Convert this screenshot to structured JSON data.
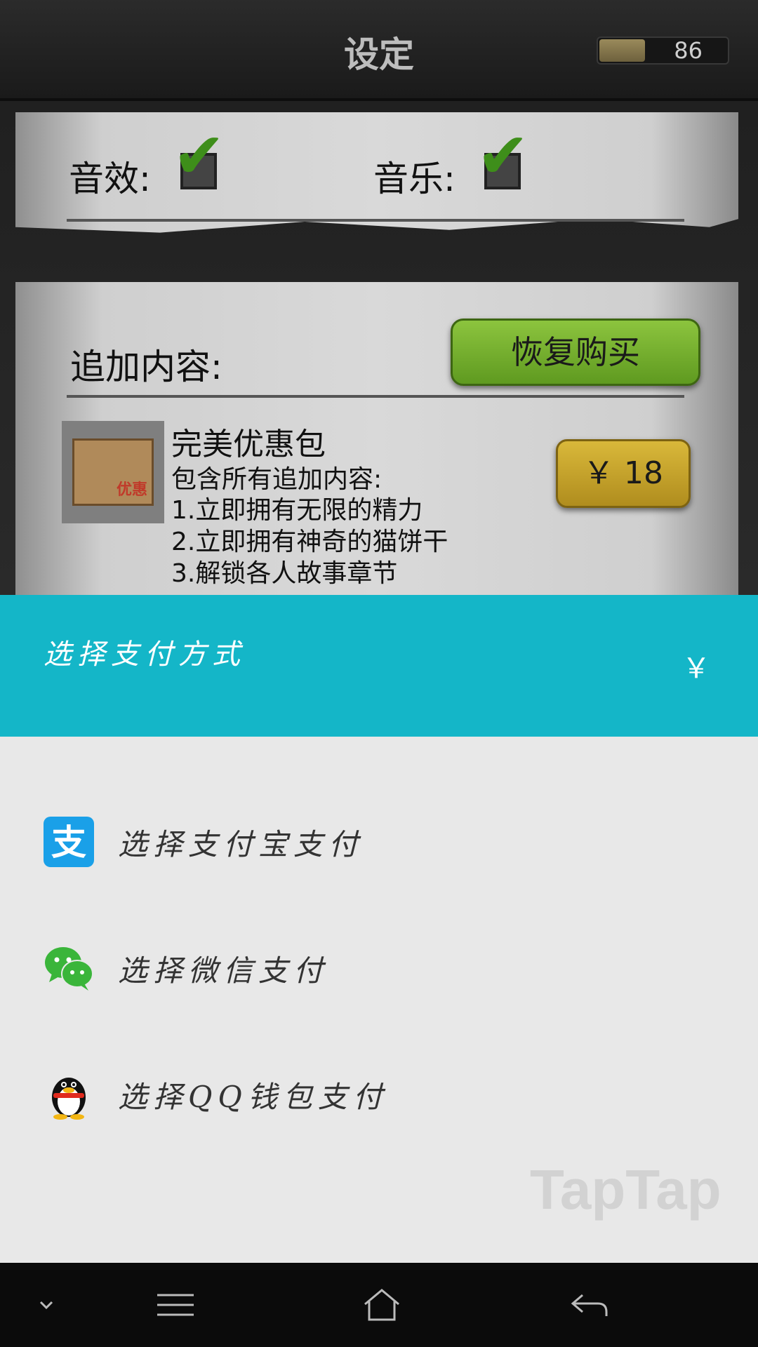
{
  "game": {
    "title": "设定",
    "energy_value": "86",
    "energy_fraction": 0.35,
    "sound_label": "音效:",
    "music_label": "音乐:",
    "sound_checked": true,
    "music_checked": true,
    "addon_label": "追加内容:",
    "restore_button": "恢复购买",
    "pack": {
      "image_text": "优惠",
      "title": "完美优惠包",
      "lines": [
        "包含所有追加内容:",
        "1.立即拥有无限的精力",
        "2.立即拥有神奇的猫饼干",
        "3.解锁各人故事章节"
      ],
      "price": "￥ 18"
    }
  },
  "payment_sheet": {
    "title": "选择支付方式",
    "currency_symbol": "￥",
    "options": [
      {
        "label": "选择支付宝支付",
        "icon": "alipay-icon"
      },
      {
        "label": "选择微信支付",
        "icon": "wechat-icon"
      },
      {
        "label": "选择QQ钱包支付",
        "icon": "qq-icon"
      }
    ],
    "watermark": "TapTap"
  },
  "navbar": {
    "icons": [
      "chevron-down-icon",
      "menu-icon",
      "home-icon",
      "back-icon"
    ]
  },
  "colors": {
    "sheet_header": "#14b6c8",
    "sheet_body": "#e8e8e8",
    "restore_green": "#7ab534",
    "price_gold": "#c9a42a"
  }
}
